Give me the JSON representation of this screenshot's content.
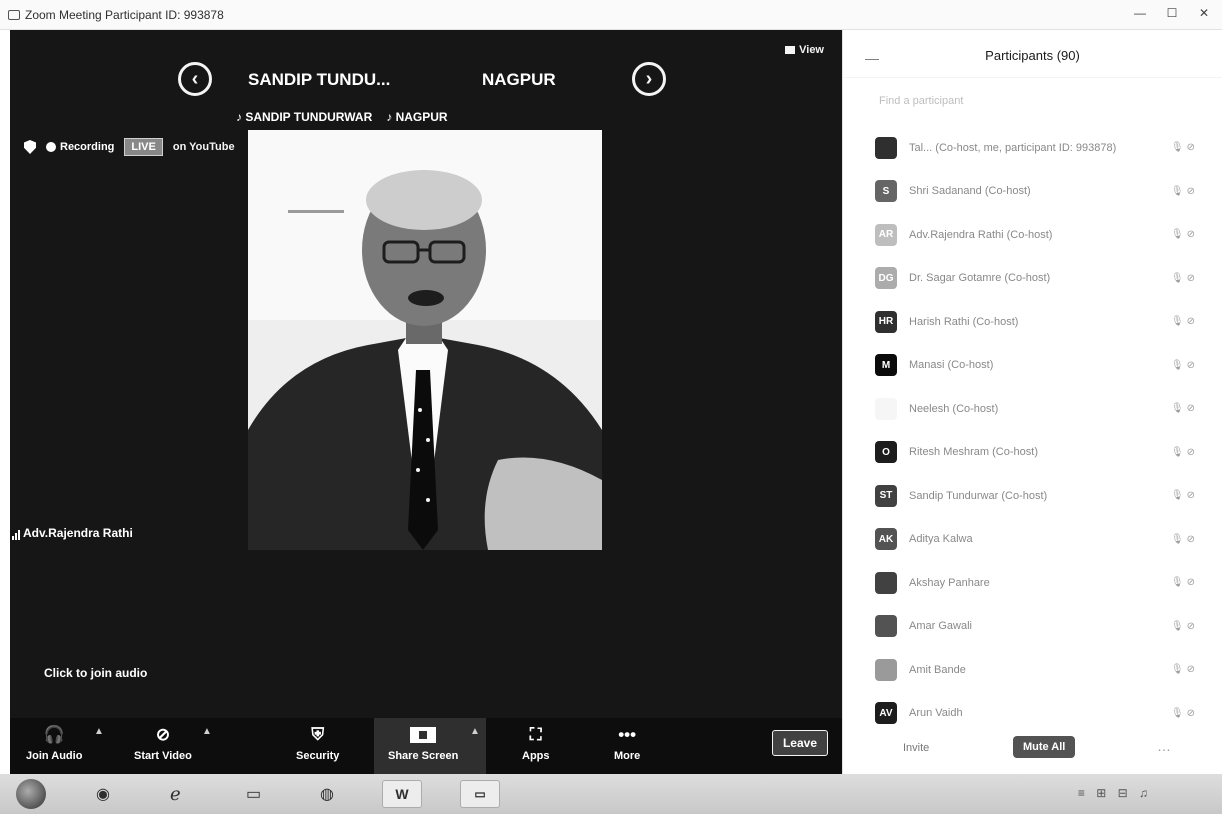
{
  "window": {
    "title": "Zoom Meeting Participant ID: 993878",
    "controls": [
      "—",
      "☐",
      "✕"
    ]
  },
  "meeting": {
    "view_label": "View",
    "speaker_tabs": [
      "SANDIP TUNDU...",
      "NAGPUR"
    ],
    "sub_tabs": [
      "SANDIP TUNDURWAR",
      "NAGPUR"
    ],
    "recording_label": "Recording",
    "live_label": "LIVE",
    "youtube_label": "on YouTube",
    "active_speaker": "Adv.Rajendra Rathi",
    "join_audio_hint": "Click to join audio"
  },
  "toolbar": {
    "join_audio": "Join Audio",
    "start_video": "Start Video",
    "security": "Security",
    "share_screen": "Share Screen",
    "apps": "Apps",
    "more": "More",
    "leave": "Leave"
  },
  "participants": {
    "title": "Participants (90)",
    "search_placeholder": "Find a participant",
    "invite": "Invite",
    "mute_all": "Mute All",
    "items": [
      {
        "initials": "",
        "name": "Tal... (Co-host, me, participant ID: 993878)",
        "audio": "",
        "avatar_color": "#333333"
      },
      {
        "initials": "S",
        "name": "Shri Sadanand (Co-host)",
        "audio": "",
        "avatar_color": "#666666"
      },
      {
        "initials": "AR",
        "name": "Adv.Rajendra Rathi (Co-host)",
        "audio": "",
        "avatar_color": "#bbbbbb"
      },
      {
        "initials": "DG",
        "name": "Dr. Sagar Gotamre (Co-host)",
        "audio": "",
        "avatar_color": "#aaaaaa"
      },
      {
        "initials": "HR",
        "name": "Harish Rathi (Co-host)",
        "audio": "",
        "avatar_color": "#333333"
      },
      {
        "initials": "M",
        "name": "Manasi (Co-host)",
        "audio": "",
        "avatar_color": "#111111"
      },
      {
        "initials": "",
        "name": "Neelesh (Co-host)",
        "audio": "",
        "avatar_color": "#f0f0f0"
      },
      {
        "initials": "O",
        "name": "Ritesh Meshram (Co-host)",
        "audio": "",
        "avatar_color": "#222222"
      },
      {
        "initials": "ST",
        "name": "Sandip Tundurwar (Co-host)",
        "audio": "",
        "avatar_color": "#444444"
      },
      {
        "initials": "AK",
        "name": "Aditya Kalwa",
        "audio": "",
        "avatar_color": "#555555"
      },
      {
        "initials": "",
        "name": "Akshay Panhare",
        "audio": "",
        "avatar_color": "#444444"
      },
      {
        "initials": "",
        "name": "Amar Gawali",
        "audio": "",
        "avatar_color": "#555555"
      },
      {
        "initials": "",
        "name": "Amit Bande",
        "audio": "",
        "avatar_color": "#999999"
      },
      {
        "initials": "AV",
        "name": "Arun Vaidh",
        "audio": "",
        "avatar_color": "#222222"
      }
    ]
  },
  "taskbar": {
    "word_label": "W",
    "tray_icons": "≡ ⊞ ⊟ ♫"
  }
}
